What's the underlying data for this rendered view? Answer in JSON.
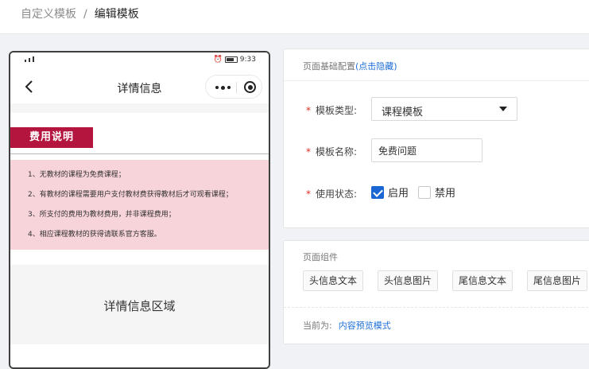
{
  "breadcrumb": {
    "parent": "自定义模板",
    "separator": "/",
    "current": "编辑模板"
  },
  "phone": {
    "status_time": "9:33",
    "nav_title": "详情信息",
    "fee_title": "费用说明",
    "fee_items": [
      "1、无教材的课程为免费课程；",
      "2、有教材的课程需要用户支付教材费获得教材后才可观看课程；",
      "3、所支付的费用为教材费用，并非课程费用；",
      "4、相应课程教材的获得请联系官方客服。"
    ],
    "detail_area_label": "详情信息区域",
    "colors": {
      "fee_tag_bg": "#b4153e",
      "fee_box_bg": "#f7d3da"
    }
  },
  "config": {
    "header_label": "页面基础配置",
    "header_link": "(点击隐藏)",
    "template_type": {
      "label": "模板类型:",
      "value": "课程模板"
    },
    "template_name": {
      "label": "模板名称:",
      "value": "免费问题"
    },
    "status": {
      "label": "使用状态:",
      "options": [
        {
          "label": "启用",
          "checked": true
        },
        {
          "label": "禁用",
          "checked": false
        }
      ]
    },
    "required_mark": "*"
  },
  "components": {
    "header_label": "页面组件",
    "items": [
      "头信息文本",
      "头信息图片",
      "尾信息文本",
      "尾信息图片"
    ],
    "mode_label": "当前为:",
    "mode_link": "内容预览模式"
  }
}
